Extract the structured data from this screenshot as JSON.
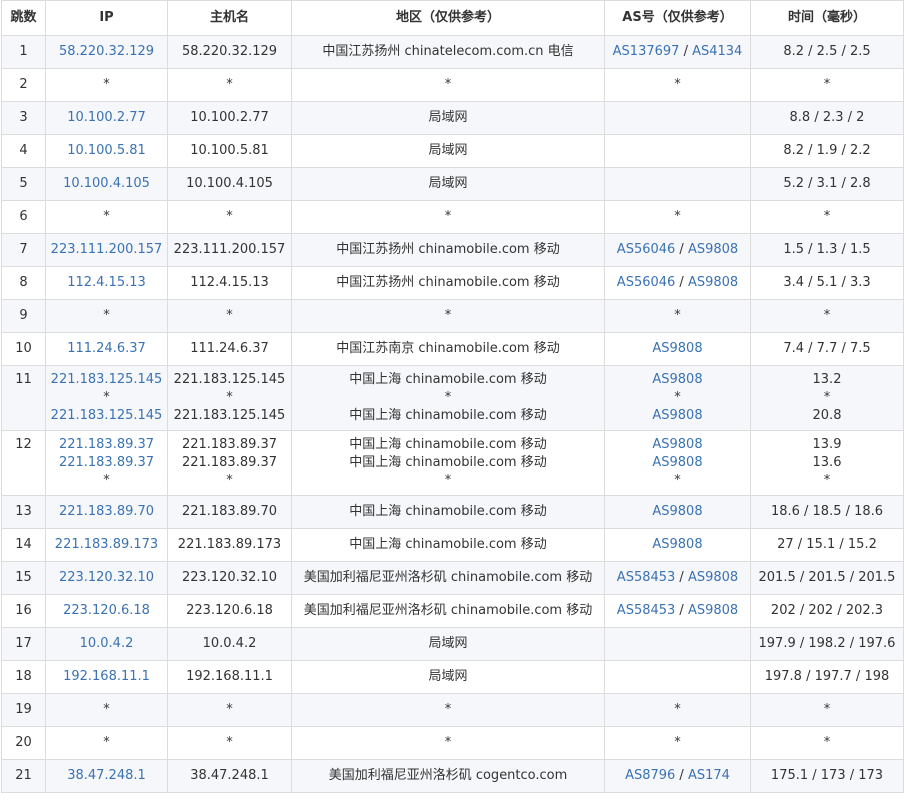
{
  "headers": {
    "hop": "跳数",
    "ip": "IP",
    "host": "主机名",
    "region": "地区（仅供参考）",
    "as": "AS号（仅供参考）",
    "time": "时间（毫秒）"
  },
  "rows": [
    {
      "hop": "1",
      "lines": [
        {
          "ip": "58.220.32.129",
          "host": "58.220.32.129",
          "region": "中国江苏扬州 chinatelecom.com.cn 电信",
          "as": [
            "AS137697",
            "AS4134"
          ],
          "time": "8.2 / 2.5 / 2.5"
        }
      ]
    },
    {
      "hop": "2",
      "lines": [
        {
          "ip": "*",
          "host": "*",
          "region": "*",
          "as": [
            "*"
          ],
          "time": "*"
        }
      ]
    },
    {
      "hop": "3",
      "lines": [
        {
          "ip": "10.100.2.77",
          "host": "10.100.2.77",
          "region": "局域网",
          "as": [],
          "time": "8.8 / 2.3 / 2"
        }
      ]
    },
    {
      "hop": "4",
      "lines": [
        {
          "ip": "10.100.5.81",
          "host": "10.100.5.81",
          "region": "局域网",
          "as": [],
          "time": "8.2 / 1.9 / 2.2"
        }
      ]
    },
    {
      "hop": "5",
      "lines": [
        {
          "ip": "10.100.4.105",
          "host": "10.100.4.105",
          "region": "局域网",
          "as": [],
          "time": "5.2 / 3.1 / 2.8"
        }
      ]
    },
    {
      "hop": "6",
      "lines": [
        {
          "ip": "*",
          "host": "*",
          "region": "*",
          "as": [
            "*"
          ],
          "time": "*"
        }
      ]
    },
    {
      "hop": "7",
      "lines": [
        {
          "ip": "223.111.200.157",
          "host": "223.111.200.157",
          "region": "中国江苏扬州 chinamobile.com 移动",
          "as": [
            "AS56046",
            "AS9808"
          ],
          "time": "1.5 / 1.3 / 1.5"
        }
      ]
    },
    {
      "hop": "8",
      "lines": [
        {
          "ip": "112.4.15.13",
          "host": "112.4.15.13",
          "region": "中国江苏扬州 chinamobile.com 移动",
          "as": [
            "AS56046",
            "AS9808"
          ],
          "time": "3.4 / 5.1 / 3.3"
        }
      ]
    },
    {
      "hop": "9",
      "lines": [
        {
          "ip": "*",
          "host": "*",
          "region": "*",
          "as": [
            "*"
          ],
          "time": "*"
        }
      ]
    },
    {
      "hop": "10",
      "lines": [
        {
          "ip": "111.24.6.37",
          "host": "111.24.6.37",
          "region": "中国江苏南京 chinamobile.com 移动",
          "as": [
            "AS9808"
          ],
          "time": "7.4 / 7.7 / 7.5"
        }
      ]
    },
    {
      "hop": "11",
      "lines": [
        {
          "ip": "221.183.125.145",
          "host": "221.183.125.145",
          "region": "中国上海 chinamobile.com 移动",
          "as": [
            "AS9808"
          ],
          "time": "13.2"
        },
        {
          "ip": "*",
          "host": "*",
          "region": "*",
          "as": [
            "*"
          ],
          "time": "*"
        },
        {
          "ip": "221.183.125.145",
          "host": "221.183.125.145",
          "region": "中国上海 chinamobile.com 移动",
          "as": [
            "AS9808"
          ],
          "time": "20.8"
        }
      ]
    },
    {
      "hop": "12",
      "lines": [
        {
          "ip": "221.183.89.37",
          "host": "221.183.89.37",
          "region": "中国上海 chinamobile.com 移动",
          "as": [
            "AS9808"
          ],
          "time": "13.9"
        },
        {
          "ip": "221.183.89.37",
          "host": "221.183.89.37",
          "region": "中国上海 chinamobile.com 移动",
          "as": [
            "AS9808"
          ],
          "time": "13.6"
        },
        {
          "ip": "*",
          "host": "*",
          "region": "*",
          "as": [
            "*"
          ],
          "time": "*"
        }
      ]
    },
    {
      "hop": "13",
      "lines": [
        {
          "ip": "221.183.89.70",
          "host": "221.183.89.70",
          "region": "中国上海 chinamobile.com 移动",
          "as": [
            "AS9808"
          ],
          "time": "18.6 / 18.5 / 18.6"
        }
      ]
    },
    {
      "hop": "14",
      "lines": [
        {
          "ip": "221.183.89.173",
          "host": "221.183.89.173",
          "region": "中国上海 chinamobile.com 移动",
          "as": [
            "AS9808"
          ],
          "time": "27 / 15.1 / 15.2"
        }
      ]
    },
    {
      "hop": "15",
      "lines": [
        {
          "ip": "223.120.32.10",
          "host": "223.120.32.10",
          "region": "美国加利福尼亚州洛杉矶 chinamobile.com 移动",
          "as": [
            "AS58453",
            "AS9808"
          ],
          "time": "201.5 / 201.5 / 201.5"
        }
      ]
    },
    {
      "hop": "16",
      "lines": [
        {
          "ip": "223.120.6.18",
          "host": "223.120.6.18",
          "region": "美国加利福尼亚州洛杉矶 chinamobile.com 移动",
          "as": [
            "AS58453",
            "AS9808"
          ],
          "time": "202 / 202 / 202.3"
        }
      ]
    },
    {
      "hop": "17",
      "lines": [
        {
          "ip": "10.0.4.2",
          "host": "10.0.4.2",
          "region": "局域网",
          "as": [],
          "time": "197.9 / 198.2 / 197.6"
        }
      ]
    },
    {
      "hop": "18",
      "lines": [
        {
          "ip": "192.168.11.1",
          "host": "192.168.11.1",
          "region": "局域网",
          "as": [],
          "time": "197.8 / 197.7 / 198"
        }
      ]
    },
    {
      "hop": "19",
      "lines": [
        {
          "ip": "*",
          "host": "*",
          "region": "*",
          "as": [
            "*"
          ],
          "time": "*"
        }
      ]
    },
    {
      "hop": "20",
      "lines": [
        {
          "ip": "*",
          "host": "*",
          "region": "*",
          "as": [
            "*"
          ],
          "time": "*"
        }
      ]
    },
    {
      "hop": "21",
      "lines": [
        {
          "ip": "38.47.248.1",
          "host": "38.47.248.1",
          "region": "美国加利福尼亚州洛杉矶 cogentco.com",
          "as": [
            "AS8796",
            "AS174"
          ],
          "time": "175.1 / 173 / 173"
        }
      ]
    }
  ],
  "colors": {
    "link": "#3a72b3",
    "border": "#dcdcdc",
    "stripe": "#f5f7fa"
  }
}
